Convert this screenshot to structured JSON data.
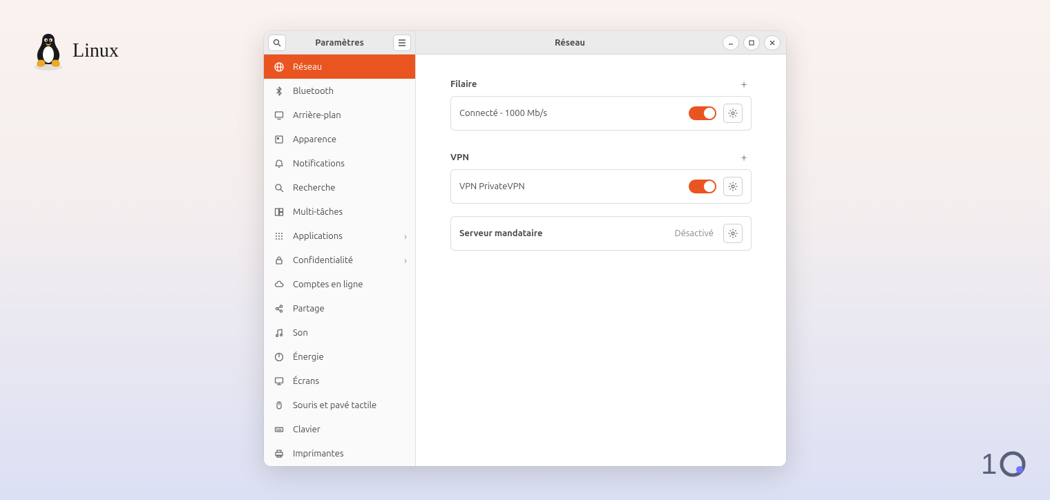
{
  "branding": {
    "label": "Linux"
  },
  "sidebar": {
    "title": "Paramètres",
    "items": [
      {
        "label": "Réseau",
        "icon": "globe",
        "active": true
      },
      {
        "label": "Bluetooth",
        "icon": "bluetooth"
      },
      {
        "label": "Arrière-plan",
        "icon": "display"
      },
      {
        "label": "Apparence",
        "icon": "appearance"
      },
      {
        "label": "Notifications",
        "icon": "bell"
      },
      {
        "label": "Recherche",
        "icon": "search"
      },
      {
        "label": "Multi-tâches",
        "icon": "multitask"
      },
      {
        "label": "Applications",
        "icon": "grid",
        "chevron": true
      },
      {
        "label": "Confidentialité",
        "icon": "lock",
        "chevron": true
      },
      {
        "label": "Comptes en ligne",
        "icon": "cloud"
      },
      {
        "label": "Partage",
        "icon": "share"
      },
      {
        "label": "Son",
        "icon": "music"
      },
      {
        "label": "Énergie",
        "icon": "power"
      },
      {
        "label": "Écrans",
        "icon": "monitor"
      },
      {
        "label": "Souris et pavé tactile",
        "icon": "mouse"
      },
      {
        "label": "Clavier",
        "icon": "keyboard"
      },
      {
        "label": "Imprimantes",
        "icon": "printer"
      }
    ]
  },
  "main": {
    "title": "Réseau",
    "sections": {
      "wired": {
        "title": "Filaire",
        "row": {
          "label": "Connecté - 1000 Mb/s",
          "toggle_on": true
        }
      },
      "vpn": {
        "title": "VPN",
        "row": {
          "label": "VPN PrivateVPN",
          "toggle_on": true
        }
      },
      "proxy": {
        "label": "Serveur mandataire",
        "status": "Désactivé"
      }
    }
  }
}
